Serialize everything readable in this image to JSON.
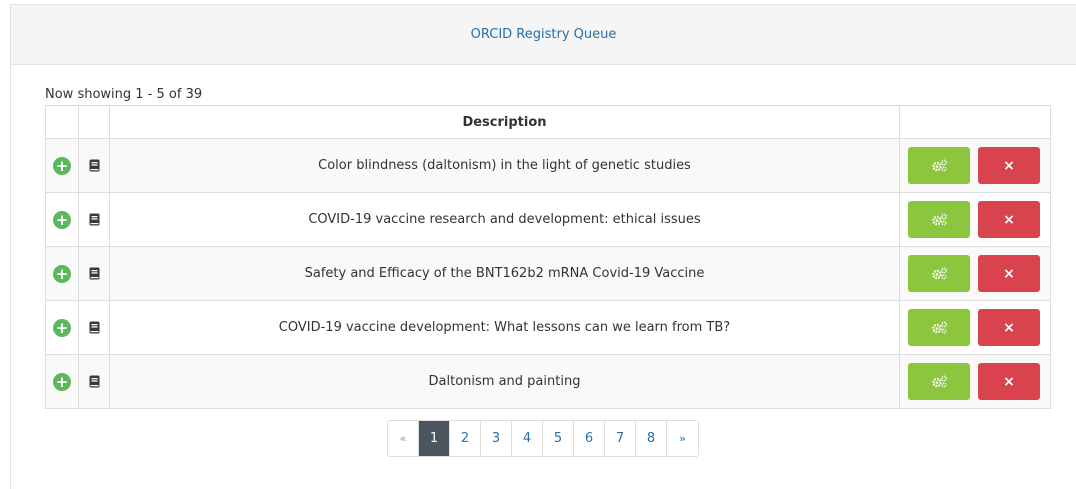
{
  "panel": {
    "title": "ORCID Registry Queue"
  },
  "showing": "Now showing 1 - 5 of 39",
  "table": {
    "headers": [
      "",
      "",
      "Description",
      ""
    ],
    "rows": [
      {
        "description": "Color blindness (daltonism) in the light of genetic studies",
        "plus": "+",
        "delete": "×"
      },
      {
        "description": "COVID-19 vaccine research and development: ethical issues",
        "plus": "+",
        "delete": "×"
      },
      {
        "description": "Safety and Efficacy of the BNT162b2 mRNA Covid-19 Vaccine",
        "plus": "+",
        "delete": "×"
      },
      {
        "description": "COVID-19 vaccine development: What lessons can we learn from TB?",
        "plus": "+",
        "delete": "×"
      },
      {
        "description": "Daltonism and painting",
        "plus": "+",
        "delete": "×"
      }
    ]
  },
  "pagination": {
    "prev": "«",
    "pages": [
      "1",
      "2",
      "3",
      "4",
      "5",
      "6",
      "7",
      "8"
    ],
    "next": "»",
    "active": "1"
  },
  "icons": {
    "plus": "plus-circle-icon",
    "book": "book-icon",
    "gears": "gears-icon",
    "delete": "times-icon"
  },
  "colors": {
    "link": "#2a6fa8",
    "success": "#5cb85c",
    "gear_button": "#8cc63f",
    "danger": "#d9434e",
    "active_page": "#4a5560"
  }
}
